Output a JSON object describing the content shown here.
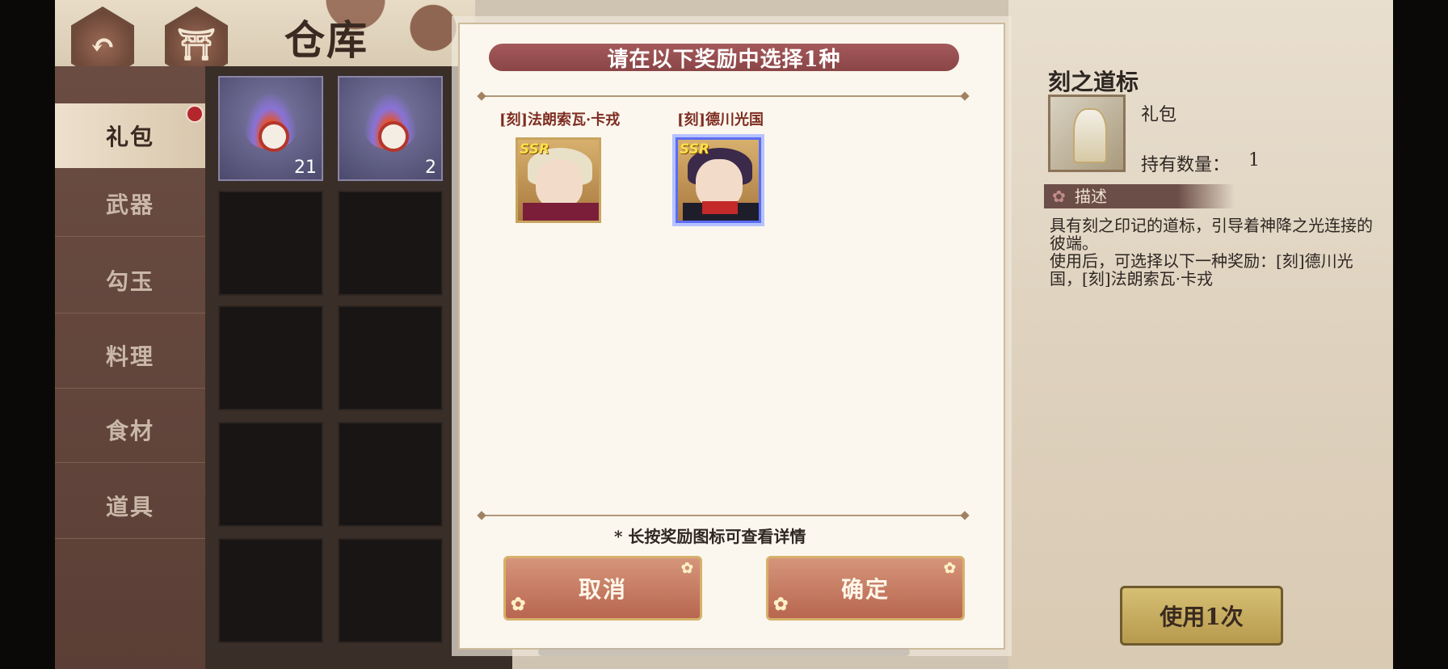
{
  "header": {
    "title": "仓库",
    "back_icon": "back-arrow-icon",
    "home_icon": "torii-gate-icon"
  },
  "sidebar": {
    "items": [
      {
        "label": "礼包",
        "active": true,
        "badge": true
      },
      {
        "label": "武器"
      },
      {
        "label": "勾玉"
      },
      {
        "label": "料理"
      },
      {
        "label": "食材"
      },
      {
        "label": "道具"
      }
    ]
  },
  "inventory": {
    "items": [
      {
        "count": "21"
      },
      {
        "count": "2"
      }
    ]
  },
  "modal": {
    "title": "请在以下奖励中选择1种",
    "options": [
      {
        "label": "[刻]法朗索瓦·卡戎",
        "rarity": "SSR",
        "selected": false
      },
      {
        "label": "[刻]德川光国",
        "rarity": "SSR",
        "selected": true
      }
    ],
    "hint": "* 长按奖励图标可查看详情",
    "cancel_label": "取消",
    "confirm_label": "确定"
  },
  "detail": {
    "name": "刻之道标",
    "type": "礼包",
    "qty_label": "持有数量：",
    "qty": "1",
    "desc_tag": "描述",
    "desc_line1": "具有刻之印记的道标，引导着神降之光连接的彼端。",
    "desc_line2": "使用后，可选择以下一种奖励：[刻]德川光国，[刻]法朗索瓦·卡戎",
    "use_label": "使用1次"
  },
  "colors": {
    "modal_header": "#9b4f51",
    "button": "#c27a62",
    "select_ring": "#5c6cf0"
  }
}
